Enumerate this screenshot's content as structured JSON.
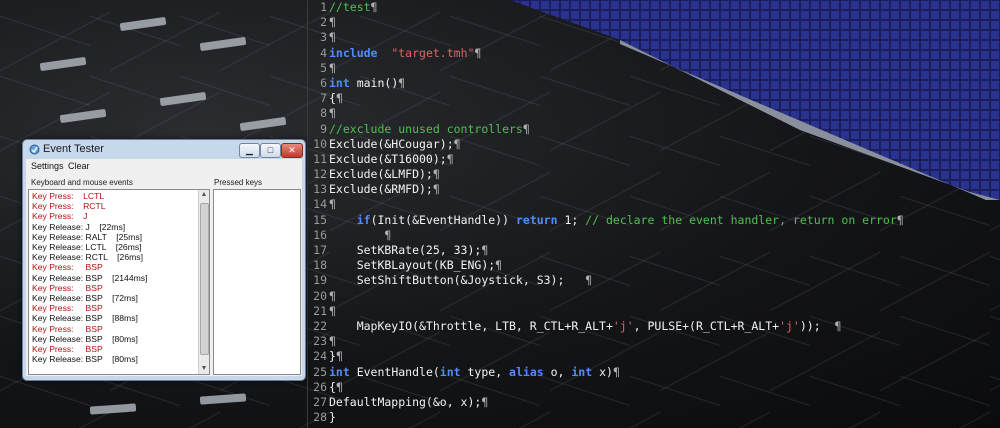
{
  "editor": {
    "lines": [
      {
        "n": "1",
        "segs": [
          [
            "cmt",
            "//test"
          ],
          [
            "pil",
            "¶"
          ]
        ]
      },
      {
        "n": "2",
        "segs": [
          [
            "pil",
            "¶"
          ]
        ]
      },
      {
        "n": "3",
        "segs": [
          [
            "pil",
            "¶"
          ]
        ]
      },
      {
        "n": "4",
        "segs": [
          [
            "kw",
            "include"
          ],
          [
            "",
            "  "
          ],
          [
            "str",
            "\"target.tmh\""
          ],
          [
            "pil",
            "¶"
          ]
        ]
      },
      {
        "n": "5",
        "segs": [
          [
            "pil",
            "¶"
          ]
        ]
      },
      {
        "n": "6",
        "segs": [
          [
            "kw",
            "int"
          ],
          [
            "",
            " main()"
          ],
          [
            "pil",
            "¶"
          ]
        ]
      },
      {
        "n": "7",
        "segs": [
          [
            "",
            "{"
          ],
          [
            "pil",
            "¶"
          ]
        ]
      },
      {
        "n": "8",
        "segs": [
          [
            "pil",
            "¶"
          ]
        ]
      },
      {
        "n": "9",
        "segs": [
          [
            "cmt",
            "//exclude unused controllers"
          ],
          [
            "pil",
            "¶"
          ]
        ]
      },
      {
        "n": "10",
        "segs": [
          [
            "",
            "Exclude(&HCougar);"
          ],
          [
            "pil",
            "¶"
          ]
        ]
      },
      {
        "n": "11",
        "segs": [
          [
            "",
            "Exclude(&T16000);"
          ],
          [
            "pil",
            "¶"
          ]
        ]
      },
      {
        "n": "12",
        "segs": [
          [
            "",
            "Exclude(&LMFD);"
          ],
          [
            "pil",
            "¶"
          ]
        ]
      },
      {
        "n": "13",
        "segs": [
          [
            "",
            "Exclude(&RMFD);"
          ],
          [
            "pil",
            "¶"
          ]
        ]
      },
      {
        "n": "14",
        "segs": [
          [
            "pil",
            "¶"
          ]
        ]
      },
      {
        "n": "15",
        "segs": [
          [
            "",
            "    "
          ],
          [
            "kw",
            "if"
          ],
          [
            "",
            "(Init(&EventHandle)) "
          ],
          [
            "kw",
            "return"
          ],
          [
            "",
            " 1; "
          ],
          [
            "cmt",
            "// declare the event handler, return on error"
          ],
          [
            "pil",
            "¶"
          ]
        ]
      },
      {
        "n": "16",
        "segs": [
          [
            "",
            "        "
          ],
          [
            "pil",
            "¶"
          ]
        ]
      },
      {
        "n": "17",
        "segs": [
          [
            "",
            "    SetKBRate(25, 33);"
          ],
          [
            "pil",
            "¶"
          ]
        ]
      },
      {
        "n": "18",
        "segs": [
          [
            "",
            "    SetKBLayout(KB_ENG);"
          ],
          [
            "pil",
            "¶"
          ]
        ]
      },
      {
        "n": "19",
        "segs": [
          [
            "",
            "    SetShiftButton(&Joystick, S3);   "
          ],
          [
            "pil",
            "¶"
          ]
        ]
      },
      {
        "n": "20",
        "segs": [
          [
            "pil",
            "¶"
          ]
        ]
      },
      {
        "n": "21",
        "segs": [
          [
            "pil",
            "¶"
          ]
        ]
      },
      {
        "n": "22",
        "segs": [
          [
            "",
            "    MapKeyIO(&Throttle, LTB, R_CTL+R_ALT+"
          ],
          [
            "str",
            "'j'"
          ],
          [
            "",
            ", PULSE+(R_CTL+R_ALT+"
          ],
          [
            "str",
            "'j'"
          ],
          [
            "",
            "));  "
          ],
          [
            "pil",
            "¶"
          ]
        ]
      },
      {
        "n": "23",
        "segs": [
          [
            "pil",
            "¶"
          ]
        ]
      },
      {
        "n": "24",
        "segs": [
          [
            "",
            "}"
          ],
          [
            "pil",
            "¶"
          ]
        ]
      },
      {
        "n": "25",
        "segs": [
          [
            "kw",
            "int"
          ],
          [
            "",
            " EventHandle("
          ],
          [
            "kw",
            "int"
          ],
          [
            "",
            " type, "
          ],
          [
            "kw",
            "alias"
          ],
          [
            "",
            " o, "
          ],
          [
            "kw",
            "int"
          ],
          [
            "",
            " x)"
          ],
          [
            "pil",
            "¶"
          ]
        ]
      },
      {
        "n": "26",
        "segs": [
          [
            "",
            "{"
          ],
          [
            "pil",
            "¶"
          ]
        ]
      },
      {
        "n": "27",
        "segs": [
          [
            "",
            "DefaultMapping(&o, x);"
          ],
          [
            "pil",
            "¶"
          ]
        ]
      },
      {
        "n": "28",
        "segs": [
          [
            "",
            "}"
          ]
        ]
      }
    ]
  },
  "event_tester": {
    "title": "Event Tester",
    "menu": [
      "Settings",
      "Clear"
    ],
    "left_group_label": "Keyboard and mouse events",
    "right_group_label": "Pressed keys",
    "events": [
      {
        "type": "press",
        "text": "Key Press:    LCTL"
      },
      {
        "type": "press",
        "text": "Key Press:    RCTL"
      },
      {
        "type": "press",
        "text": "Key Press:    J"
      },
      {
        "type": "release",
        "text": "Key Release: J    [22ms]"
      },
      {
        "type": "release",
        "text": "Key Release: RALT    [25ms]"
      },
      {
        "type": "release",
        "text": "Key Release: LCTL    [26ms]"
      },
      {
        "type": "release",
        "text": "Key Release: RCTL    [26ms]"
      },
      {
        "type": "press",
        "text": "Key Press:     BSP"
      },
      {
        "type": "release",
        "text": "Key Release: BSP    [2144ms]"
      },
      {
        "type": "press",
        "text": "Key Press:     BSP"
      },
      {
        "type": "release",
        "text": "Key Release: BSP    [72ms]"
      },
      {
        "type": "press",
        "text": "Key Press:     BSP"
      },
      {
        "type": "release",
        "text": "Key Release: BSP    [88ms]"
      },
      {
        "type": "press",
        "text": "Key Press:     BSP"
      },
      {
        "type": "release",
        "text": "Key Release: BSP    [80ms]"
      },
      {
        "type": "press",
        "text": "Key Press:     BSP"
      },
      {
        "type": "release",
        "text": "Key Release: BSP    [80ms]"
      }
    ]
  },
  "colors": {
    "keyword": "#4f8cff",
    "string": "#e06363",
    "comment": "#4ec04e",
    "key_press": "#b01010"
  }
}
